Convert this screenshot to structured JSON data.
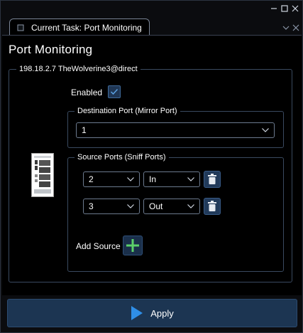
{
  "window": {
    "controls": [
      "minimize-icon",
      "maximize-icon",
      "close-icon"
    ]
  },
  "tab": {
    "label": "Current Task: Port Monitoring",
    "controls": [
      "chevron-down-icon",
      "close-icon"
    ]
  },
  "page": {
    "title": "Port Monitoring"
  },
  "device_group": {
    "legend": "198.18.2.7  TheWolverine3@direct",
    "enabled_label": "Enabled",
    "enabled_checked": true
  },
  "destination": {
    "legend": "Destination Port (Mirror Port)",
    "port_value": "1"
  },
  "sources": {
    "legend": "Source Ports (Sniff Ports)",
    "rows": [
      {
        "port": "2",
        "direction": "In"
      },
      {
        "port": "3",
        "direction": "Out"
      }
    ],
    "add_label": "Add Source"
  },
  "footer": {
    "apply_label": "Apply"
  },
  "colors": {
    "accent": "#1c3552",
    "check": "#5aa0e0",
    "add_plus": "#5cd06a",
    "play": "#2f8fe8"
  }
}
